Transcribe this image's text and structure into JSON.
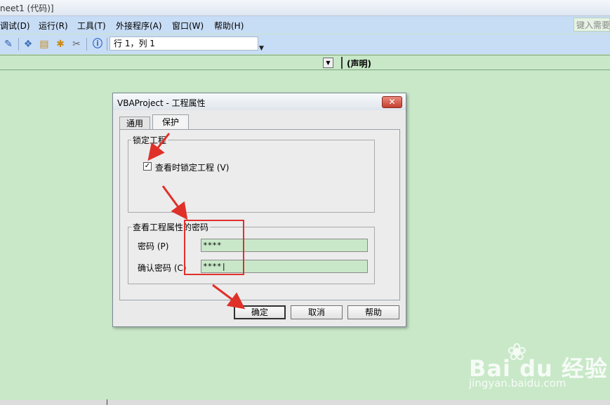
{
  "window": {
    "title_fragment": "neet1 (代码)]"
  },
  "menubar": {
    "items": [
      "调试(D)",
      "运行(R)",
      "工具(T)",
      "外接程序(A)",
      "窗口(W)",
      "帮助(H)"
    ],
    "help_search_placeholder": "键入需要"
  },
  "toolbar": {
    "position_text": "行 1，列 1"
  },
  "objbar": {
    "procedure": "(声明)"
  },
  "dialog": {
    "title": "VBAProject - 工程属性",
    "close_label": "✕",
    "tabs": [
      {
        "label": "通用",
        "active": false
      },
      {
        "label": "保护",
        "active": true
      }
    ],
    "lock_group": {
      "legend": "锁定工程",
      "checkbox_label": "查看时锁定工程 (V)",
      "checked": true
    },
    "password_group": {
      "legend": "查看工程属性的密码",
      "password_label": "密码 (P)",
      "password_value": "****",
      "confirm_label": "确认密码 (C)",
      "confirm_value": "****|"
    },
    "buttons": {
      "ok": "确定",
      "cancel": "取消",
      "help": "帮助"
    }
  },
  "watermark": {
    "logo": "Bai du 经验",
    "url": "jingyan.baidu.com"
  },
  "colors": {
    "code_background": "#c8e8c8",
    "menubar": "#c7dcf5",
    "annotation": "#e0302a"
  }
}
